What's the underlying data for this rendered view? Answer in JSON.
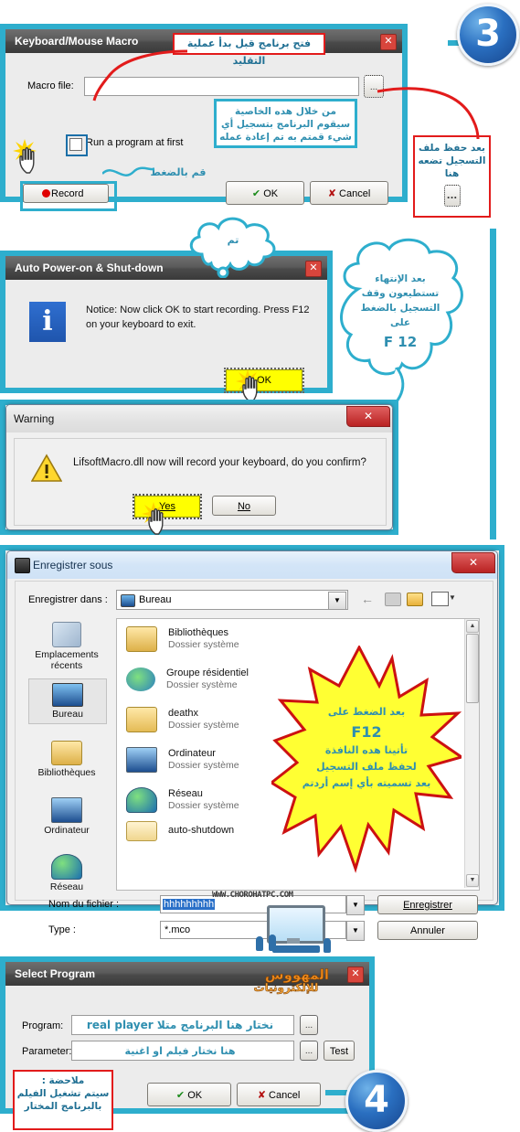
{
  "steps": {
    "three": "3",
    "four": "4"
  },
  "macro_dialog": {
    "title": "Keyboard/Mouse Macro",
    "close_icon": "✕",
    "macro_file_label": "Macro file:",
    "macro_file_value": "",
    "browse_label": "...",
    "checkbox_label": "Run a program at first",
    "record_label": "Record",
    "ok_label": "OK",
    "cancel_label": "Cancel",
    "note_top": "فتح برنامج قبل بدأ عملية التقليد",
    "note_feature_lines": [
      "من خلال هده الخاصية",
      "سيقوم البرنامج بتسجيل أي",
      "شيء قمتم به تم إعادة عمله"
    ],
    "note_press": "قم بالضغط",
    "note_right_lines": [
      "بعد حفظ ملف",
      "التسجيل تضعه",
      "هنا"
    ],
    "note_right_button": "..."
  },
  "notice_dialog": {
    "title": "Auto Power-on & Shut-down",
    "close_icon": "✕",
    "info_icon": "i",
    "message": "Notice: Now click OK to start recording. Press F12 on your keyboard to exit.",
    "ok_label": "OK",
    "cloud_done": "تم",
    "cloud_f12_lines": [
      "بعد الإنتهاء",
      "تستطيعون وقف",
      "التسجيل بالضغط",
      "على"
    ],
    "cloud_f12_key": "F 12"
  },
  "warning_dialog": {
    "title": "Warning",
    "close_icon": "✕",
    "warn_icon": "!",
    "message": "LifsoftMacro.dll now will record your keyboard, do you confirm?",
    "yes_label": "Yes",
    "no_label": "No"
  },
  "save_dialog": {
    "title": "Enregistrer sous",
    "close_icon": "✕",
    "save_in_label": "Enregistrer dans :",
    "save_in_value": "Bureau",
    "toolbar": {
      "back_icon": "←",
      "up_icon": "up-folder",
      "newfolder_icon": "new-folder",
      "views_icon": "views"
    },
    "places": [
      {
        "label_line1": "Emplacements",
        "label_line2": "récents",
        "icon": "recent-places-icon",
        "selected": false
      },
      {
        "label_line1": "Bureau",
        "label_line2": "",
        "icon": "desktop-icon",
        "selected": true
      },
      {
        "label_line1": "Bibliothèques",
        "label_line2": "",
        "icon": "libraries-icon",
        "selected": false
      },
      {
        "label_line1": "Ordinateur",
        "label_line2": "",
        "icon": "computer-icon",
        "selected": false
      },
      {
        "label_line1": "Réseau",
        "label_line2": "",
        "icon": "network-icon",
        "selected": false
      }
    ],
    "files": [
      {
        "name": "Bibliothèques",
        "sub": "Dossier système",
        "icon": "libraries-icon"
      },
      {
        "name": "Groupe résidentiel",
        "sub": "Dossier système",
        "icon": "homegroup-icon"
      },
      {
        "name": "deathx",
        "sub": "Dossier système",
        "icon": "user-folder-icon"
      },
      {
        "name": "Ordinateur",
        "sub": "Dossier système",
        "icon": "computer-icon"
      },
      {
        "name": "Réseau",
        "sub": "Dossier système",
        "icon": "network-icon"
      },
      {
        "name": "auto-shutdown",
        "sub": "",
        "icon": "folder-icon"
      }
    ],
    "filename_label": "Nom du fichier :",
    "filename_value": "hhhhhhhhh",
    "type_label": "Type :",
    "type_value": "*.mco",
    "save_button": "Enregistrer",
    "cancel_button": "Annuler",
    "star_lines": [
      "بعد الضغط على",
      "F12",
      "تأتينا هده النافذة",
      "لحفظ ملف التسجيل",
      "بعد تسميته بأي إسم أردتم"
    ],
    "watermark": "WWW.CHOROHATPC.COM"
  },
  "select_program_dialog": {
    "title": "Select Program",
    "close_icon": "✕",
    "brand_line1": "المهووس",
    "brand_line2": "للإلكترونيات",
    "program_label": "Program:",
    "program_value": "نختار هنا البرنامج متلا real player",
    "parameter_label": "Parameter:",
    "parameter_value": "هنا نختار فيلم او اغنية",
    "browse_label": "...",
    "test_label": "Test",
    "ok_label": "OK",
    "cancel_label": "Cancel",
    "note_title": "ملاحضة :",
    "note_lines": [
      "سيتم تشغيل الفيلم",
      "بالبرنامج المختار"
    ]
  },
  "colors": {
    "teal": "#2eaecd",
    "annotation_blue": "#2f8fb0",
    "annotation_red": "#e21b1b",
    "star_fill": "#ffff33",
    "star_stroke": "#cc1111",
    "highlight_yellow": "#ffff00"
  }
}
